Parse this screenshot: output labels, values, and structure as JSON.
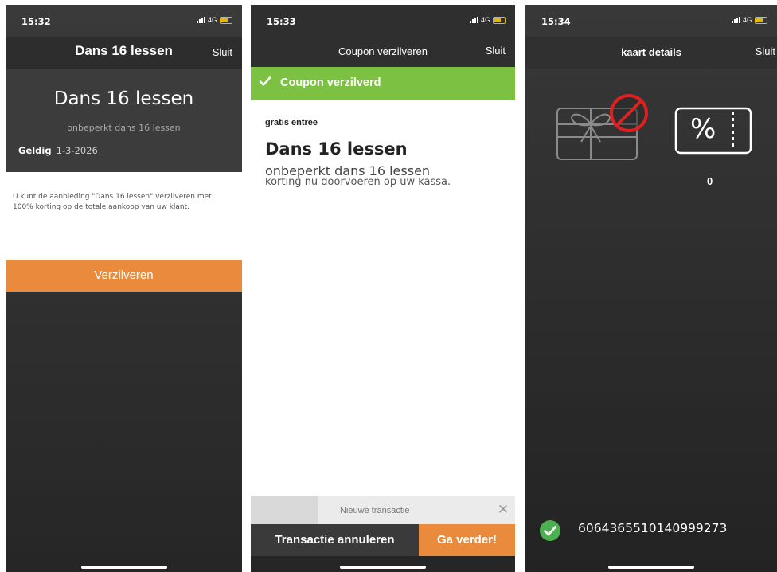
{
  "screen1": {
    "status": {
      "time": "15:32",
      "network": "4G"
    },
    "nav": {
      "title": "Dans 16 lessen",
      "close_label": "Sluit"
    },
    "card": {
      "title": "Dans 16 lessen",
      "subtitle": "onbeperkt dans 16 lessen",
      "valid_label": "Geldig",
      "valid_date": "1-3-2026"
    },
    "info_text": "U kunt de aanbieding \"Dans 16 lessen\" verzilveren met 100% korting op de totale aankoop van uw klant.",
    "redeem_label": "Verzilveren",
    "colors": {
      "accent": "#e98a3c"
    }
  },
  "screen2": {
    "status": {
      "time": "15:33",
      "network": "4G"
    },
    "nav": {
      "title": "Coupon verzilveren",
      "close_label": "Sluit"
    },
    "banner": {
      "text": "Coupon verzilverd",
      "icon": "checkmark-icon",
      "color": "#7dc142"
    },
    "coupon": {
      "label": "gratis entree",
      "title": "Dans 16 lessen",
      "subtitle": "onbeperkt dans 16 lessen",
      "note": "korting nu doorvoeren op uw kassa."
    },
    "new_transaction": {
      "label": "Nieuwe transactie",
      "close_icon": "close-icon"
    },
    "buttons": {
      "cancel_label": "Transactie annuleren",
      "proceed_label": "Ga verder!"
    }
  },
  "screen3": {
    "status": {
      "time": "15:34",
      "network": "4G"
    },
    "nav": {
      "title": "kaart details",
      "close_label": "Sluit"
    },
    "icons": {
      "gift": "gift-card-no-icon",
      "percent": "percent-coupon-icon"
    },
    "percent_symbol": "%",
    "coupon_count": "0",
    "card_number": "6064365510140999273",
    "colors": {
      "success": "#4caf50",
      "no_sign": "#e02020"
    }
  }
}
